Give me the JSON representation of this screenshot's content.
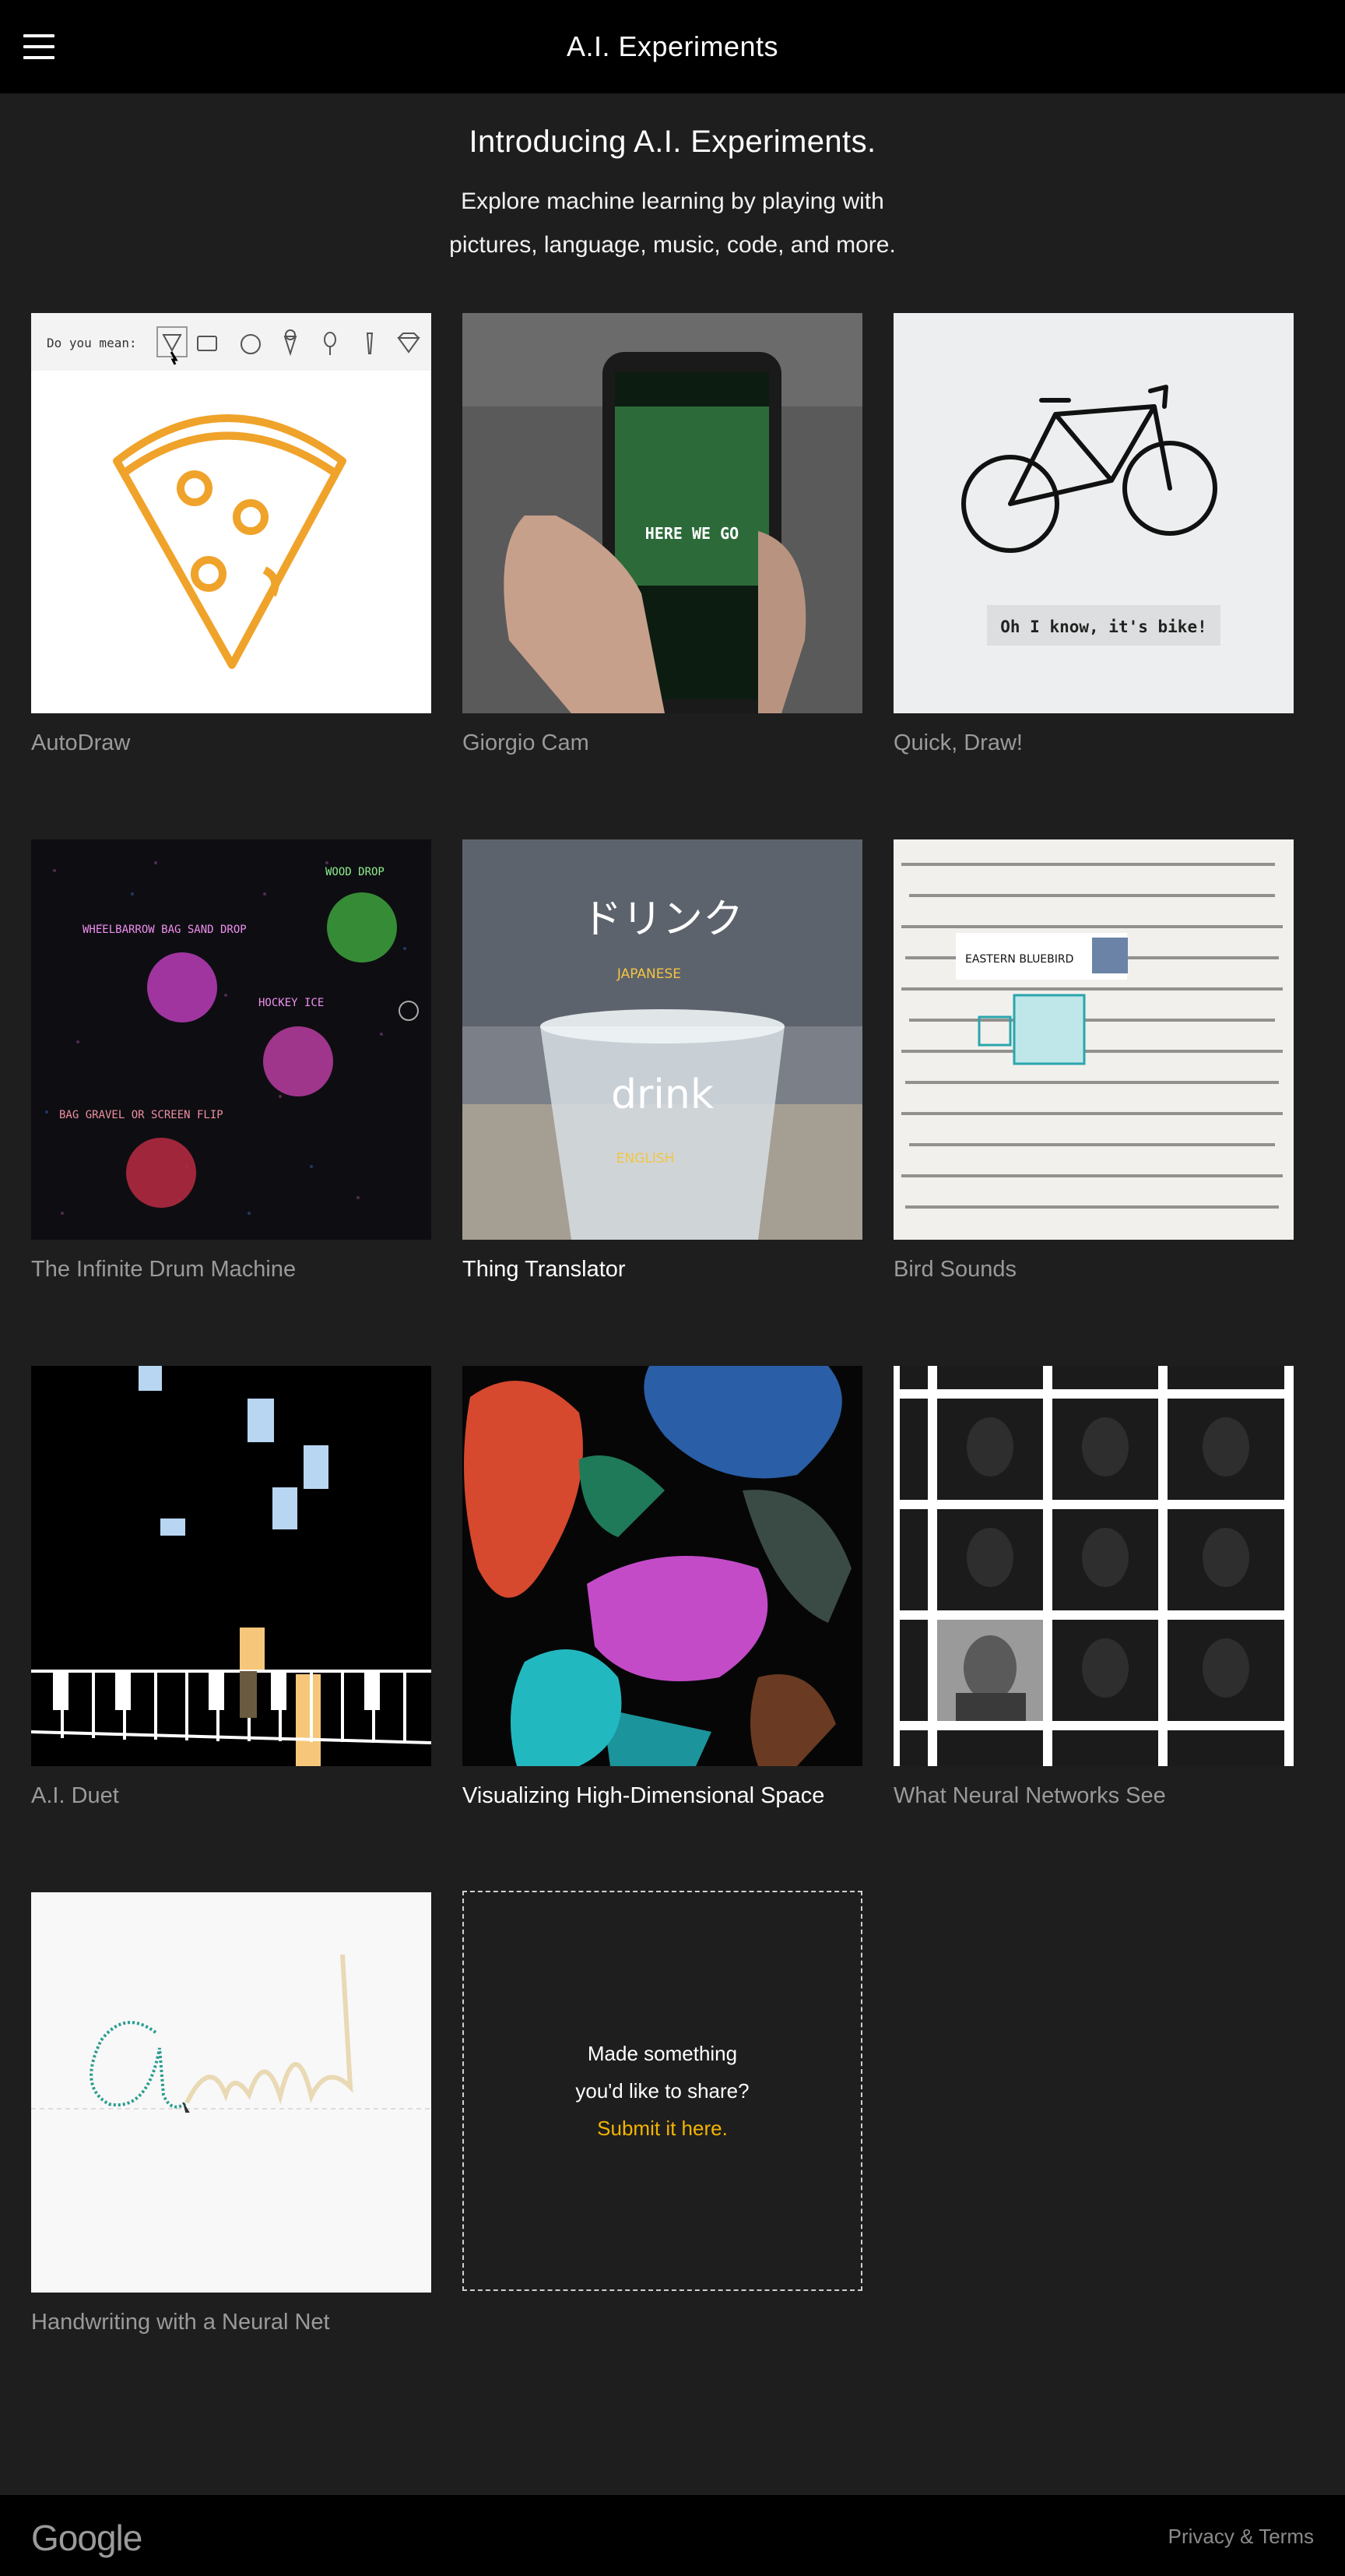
{
  "header": {
    "title": "A.I. Experiments",
    "menu_icon": "hamburger-menu-icon"
  },
  "intro": {
    "heading": "Introducing A.I. Experiments.",
    "line1": "Explore machine learning by playing with",
    "line2": "pictures, language, music, code, and more."
  },
  "experiments": [
    {
      "title": "AutoDraw",
      "autodraw_prompt": "Do you mean:"
    },
    {
      "title": "Giorgio Cam",
      "phone_text": "HERE WE GO"
    },
    {
      "title": "Quick, Draw!",
      "bubble": "Oh I know, it's bike!"
    },
    {
      "title": "The Infinite Drum Machine",
      "labels": [
        "WOOD DROP",
        "WHEELBARROW BAG SAND DROP",
        "HOCKEY ICE",
        "BAG GRAVEL OR SCREEN FLIP"
      ]
    },
    {
      "title": "Thing Translator",
      "word_jp": "ドリンク",
      "lang_jp": "JAPANESE",
      "word_en": "drink",
      "lang_en": "ENGLISH"
    },
    {
      "title": "Bird Sounds",
      "bird_label": "EASTERN BLUEBIRD"
    },
    {
      "title": "A.I. Duet"
    },
    {
      "title": "Visualizing High-Dimensional Space"
    },
    {
      "title": "What Neural Networks See"
    },
    {
      "title": "Handwriting with a Neural Net"
    }
  ],
  "submit": {
    "line1": "Made something",
    "line2": "you'd like to share?",
    "link": "Submit it here."
  },
  "footer": {
    "logo": "Google",
    "privacy": "Privacy & Terms"
  },
  "colors": {
    "background": "#1e1e1e",
    "topbar": "#000000",
    "accent": "#f4b400",
    "caption": "#9a9a9a"
  }
}
